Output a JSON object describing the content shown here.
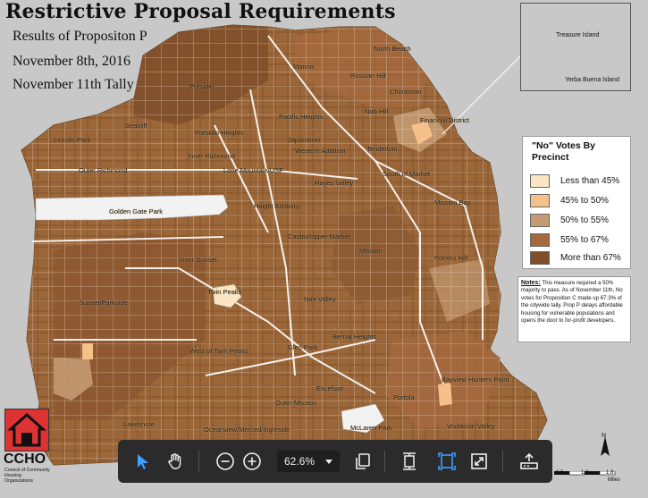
{
  "map": {
    "title": "Restrictive Proposal Requirements",
    "subtitle_lines": [
      "Results of Propositon P",
      "November 8th, 2016",
      "November 11th Tally"
    ],
    "colors": {
      "background": "#c8c8c8",
      "lt45": "#fbe6c4",
      "c45_50": "#f6c08a",
      "c50_55": "#c49a72",
      "c55_67": "#a5693d",
      "gt67": "#7f4f2a",
      "park": "#f2f2f2",
      "street": "#ffffff"
    },
    "neighborhoods": {
      "marina": "Marina",
      "presidio": "Presidio",
      "seacliff": "Seacliff",
      "lincoln_park": "Lincoln Park",
      "outer_richmond": "Outer Richmond",
      "inner_richmond": "Inner Richmond",
      "presidio_heights": "Presidio Heights",
      "pacific_heights": "Pacific Heights",
      "japantown": "Japantown",
      "western_addition": "Western Addition",
      "lone_mountain_usf": "Lone Mountain/USF",
      "hayes_valley": "Hayes Valley",
      "golden_gate_park": "Golden Gate Park",
      "haight_ashbury": "Haight Ashbury",
      "inner_sunset": "Inner Sunset",
      "sunset_parkside": "Sunset/Parkside",
      "twin_peaks": "Twin Peaks",
      "noe_valley": "Noe Valley",
      "castro_upper_market": "Castro/Upper Market",
      "mission": "Mission",
      "potrero_hill": "Potrero Hill",
      "mission_bay": "Mission Bay",
      "south_of_market": "South of Market",
      "tenderloin": "Tenderloin",
      "nob_hill": "Nob Hill",
      "russian_hill": "Russian Hill",
      "north_beach": "North Beach",
      "chinatown": "Chinatown",
      "financial_district": "Financial District",
      "west_of_twin_peaks": "West of Twin Peaks",
      "glen_park": "Glen Park",
      "bernal_heights": "Bernal Heights",
      "outer_mission": "Outer Mission",
      "excelsior": "Excelsior",
      "portola": "Portola",
      "bayview_hunters_point": "Bayview Hunters Point",
      "lakeshore": "Lakeshore",
      "oceanview_merced_ingleside": "Oceanview/Merced/Ingleside",
      "mclaren_park": "McLaren Park",
      "visitacion_valley": "Visitacion Valley"
    },
    "inset": {
      "treasure_island": "Treasure Island",
      "yerba_buena_island": "Yerba Buena Island"
    },
    "legend": {
      "title": "\"No\" Votes By Precinct",
      "items": [
        {
          "label": "Less than 45%",
          "color": "#fbe6c4"
        },
        {
          "label": "45% to 50%",
          "color": "#f6c08a"
        },
        {
          "label": "50% to 55%",
          "color": "#c49a72"
        },
        {
          "label": "55% to 67%",
          "color": "#a5693d"
        },
        {
          "label": "More than 67%",
          "color": "#7f4f2a"
        }
      ]
    },
    "notes": {
      "heading": "Notes:",
      "text": "This measure required a 50% majority to pass. As of November 11th, No votes for Proposition C made up 67.3% of the citywide tally. Prop P delays affordable housing for vulnerable populations and opens the door to for-profit developers."
    },
    "org": {
      "short": "CCHO",
      "full": "Council of Community Housing Organizations"
    },
    "scale": {
      "ticks": [
        "0.6",
        "1.2",
        "1.8"
      ],
      "unit": "Miles"
    },
    "north_label": "N"
  },
  "viewer": {
    "zoom_value": "62.6%",
    "icons": [
      "cursor-icon",
      "hand-icon",
      "zoom-out-icon",
      "zoom-in-icon",
      "page-icon",
      "fit-height-icon",
      "fit-page-icon",
      "fullscreen-icon",
      "download-icon"
    ]
  }
}
